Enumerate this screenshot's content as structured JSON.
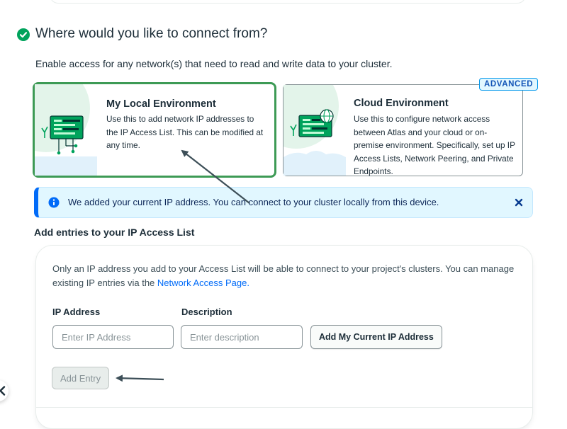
{
  "section": {
    "title": "Where would you like to connect from?",
    "description": "Enable access for any network(s) that need to read and write data to your cluster."
  },
  "environments": {
    "local": {
      "title": "My Local Environment",
      "text": "Use this to add network IP addresses to the IP Access List. This can be modified at any time."
    },
    "cloud": {
      "title": "Cloud Environment",
      "badge": "ADVANCED",
      "text": "Use this to configure network access between Atlas and your cloud or on-premise environment. Specifically, set up IP Access Lists, Network Peering, and Private Endpoints."
    }
  },
  "banner": {
    "text": "We added your current IP address. You can connect to your cluster locally from this device."
  },
  "entries": {
    "title": "Add entries to your IP Access List",
    "description_prefix": "Only an IP address you add to your Access List will be able to connect to your project's clusters. You can manage existing IP entries via the ",
    "description_link": "Network Access Page.",
    "ip_label": "IP Address",
    "ip_placeholder": "Enter IP Address",
    "ip_value": "",
    "desc_label": "Description",
    "desc_placeholder": "Enter description",
    "desc_value": "",
    "add_current_ip_label": "Add My Current IP Address",
    "add_entry_label": "Add Entry"
  },
  "colors": {
    "selected_border": "#3d9a55",
    "brand_green": "#00a35c",
    "info_blue": "#016bf8",
    "banner_bg": "#e1f7ff",
    "annotation_arrow": "#3d4f58"
  },
  "icons": {
    "section_status": "check-circle-icon",
    "banner_info": "info-icon",
    "banner_close": "close-x-icon",
    "side_nav": "chevron-left-icon"
  }
}
